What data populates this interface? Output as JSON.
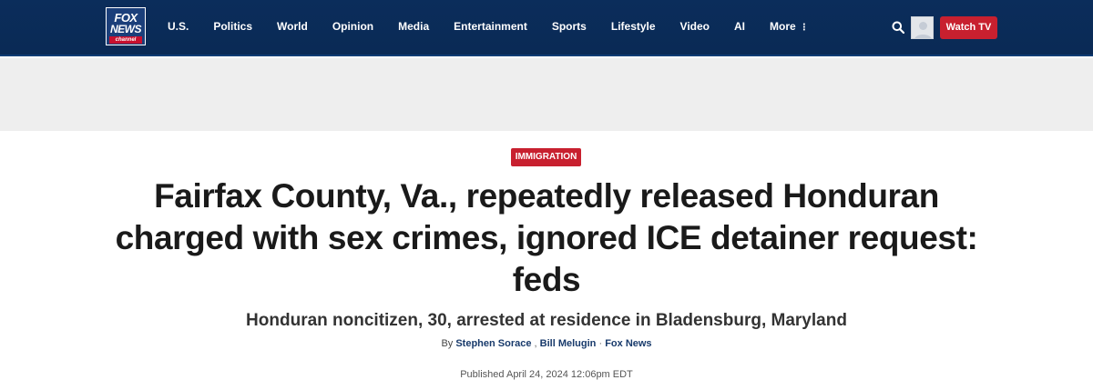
{
  "header": {
    "logo": {
      "line1": "FOX",
      "line2": "NEWS",
      "line3": "channel"
    },
    "nav": [
      {
        "label": "U.S."
      },
      {
        "label": "Politics"
      },
      {
        "label": "World"
      },
      {
        "label": "Opinion"
      },
      {
        "label": "Media"
      },
      {
        "label": "Entertainment"
      },
      {
        "label": "Sports"
      },
      {
        "label": "Lifestyle"
      },
      {
        "label": "Video"
      },
      {
        "label": "AI"
      },
      {
        "label": "More",
        "more_icon": "⋮"
      }
    ],
    "search_icon": "search-icon",
    "watch_tv_label": "Watch TV",
    "colors": {
      "bar": "#0b2d5b",
      "accent": "#c8202f"
    }
  },
  "article": {
    "kicker": "IMMIGRATION",
    "headline": "Fairfax County, Va., repeatedly released Honduran charged with sex crimes, ignored ICE detainer request: feds",
    "subhead": "Honduran noncitizen, 30, arrested at residence in Bladensburg, Maryland",
    "byline": {
      "prefix": "By",
      "authors": [
        "Stephen Sorace",
        "Bill Melugin"
      ],
      "separator": ",",
      "dot": "·",
      "source": "Fox News"
    },
    "published": "Published April 24, 2024 12:06pm EDT"
  }
}
